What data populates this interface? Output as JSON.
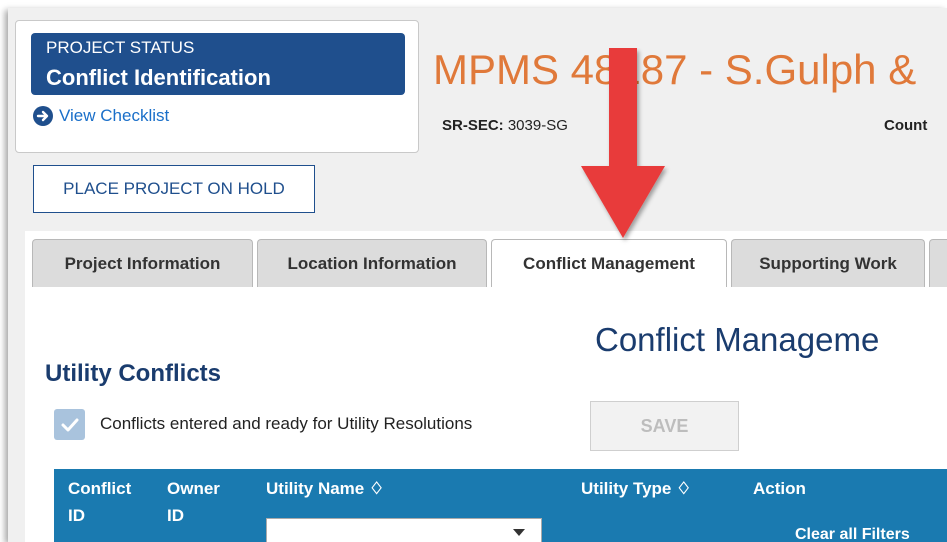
{
  "status": {
    "label": "PROJECT STATUS",
    "value": "Conflict Identification",
    "checklist_link": "View Checklist"
  },
  "project": {
    "title": "MPMS 48187 - S.Gulph &",
    "srsec_label": "SR-SEC:",
    "srsec_value": "3039-SG",
    "county_label": "Count"
  },
  "actions": {
    "hold_button": "PLACE PROJECT ON HOLD"
  },
  "tabs": [
    {
      "label": "Project Information",
      "active": false
    },
    {
      "label": "Location Information",
      "active": false
    },
    {
      "label": "Conflict Management",
      "active": true
    },
    {
      "label": "Supporting Work",
      "active": false
    },
    {
      "label": "",
      "active": false
    }
  ],
  "content": {
    "page_heading": "Conflict Manageme",
    "section_heading": "Utility Conflicts",
    "ready_checkbox": {
      "label": "Conflicts entered and ready for Utility Resolutions",
      "checked": true
    },
    "save_button": "SAVE"
  },
  "table": {
    "headers": [
      {
        "label": "Conflict ID",
        "sortable": false
      },
      {
        "label": "Owner ID",
        "sortable": false
      },
      {
        "label": "Utility Name",
        "sortable": true
      },
      {
        "label": "Utility Type",
        "sortable": true
      },
      {
        "label": "Action",
        "sortable": false
      }
    ],
    "sort_glyph": "♢",
    "filter_value": "",
    "clear_filters": "Clear all Filters"
  },
  "colors": {
    "status_bg": "#1f4f8d",
    "title_orange": "#e0793a",
    "heading_navy": "#1a3c6e",
    "table_header": "#1a7ab0",
    "annotation_arrow": "#e83a3a"
  }
}
